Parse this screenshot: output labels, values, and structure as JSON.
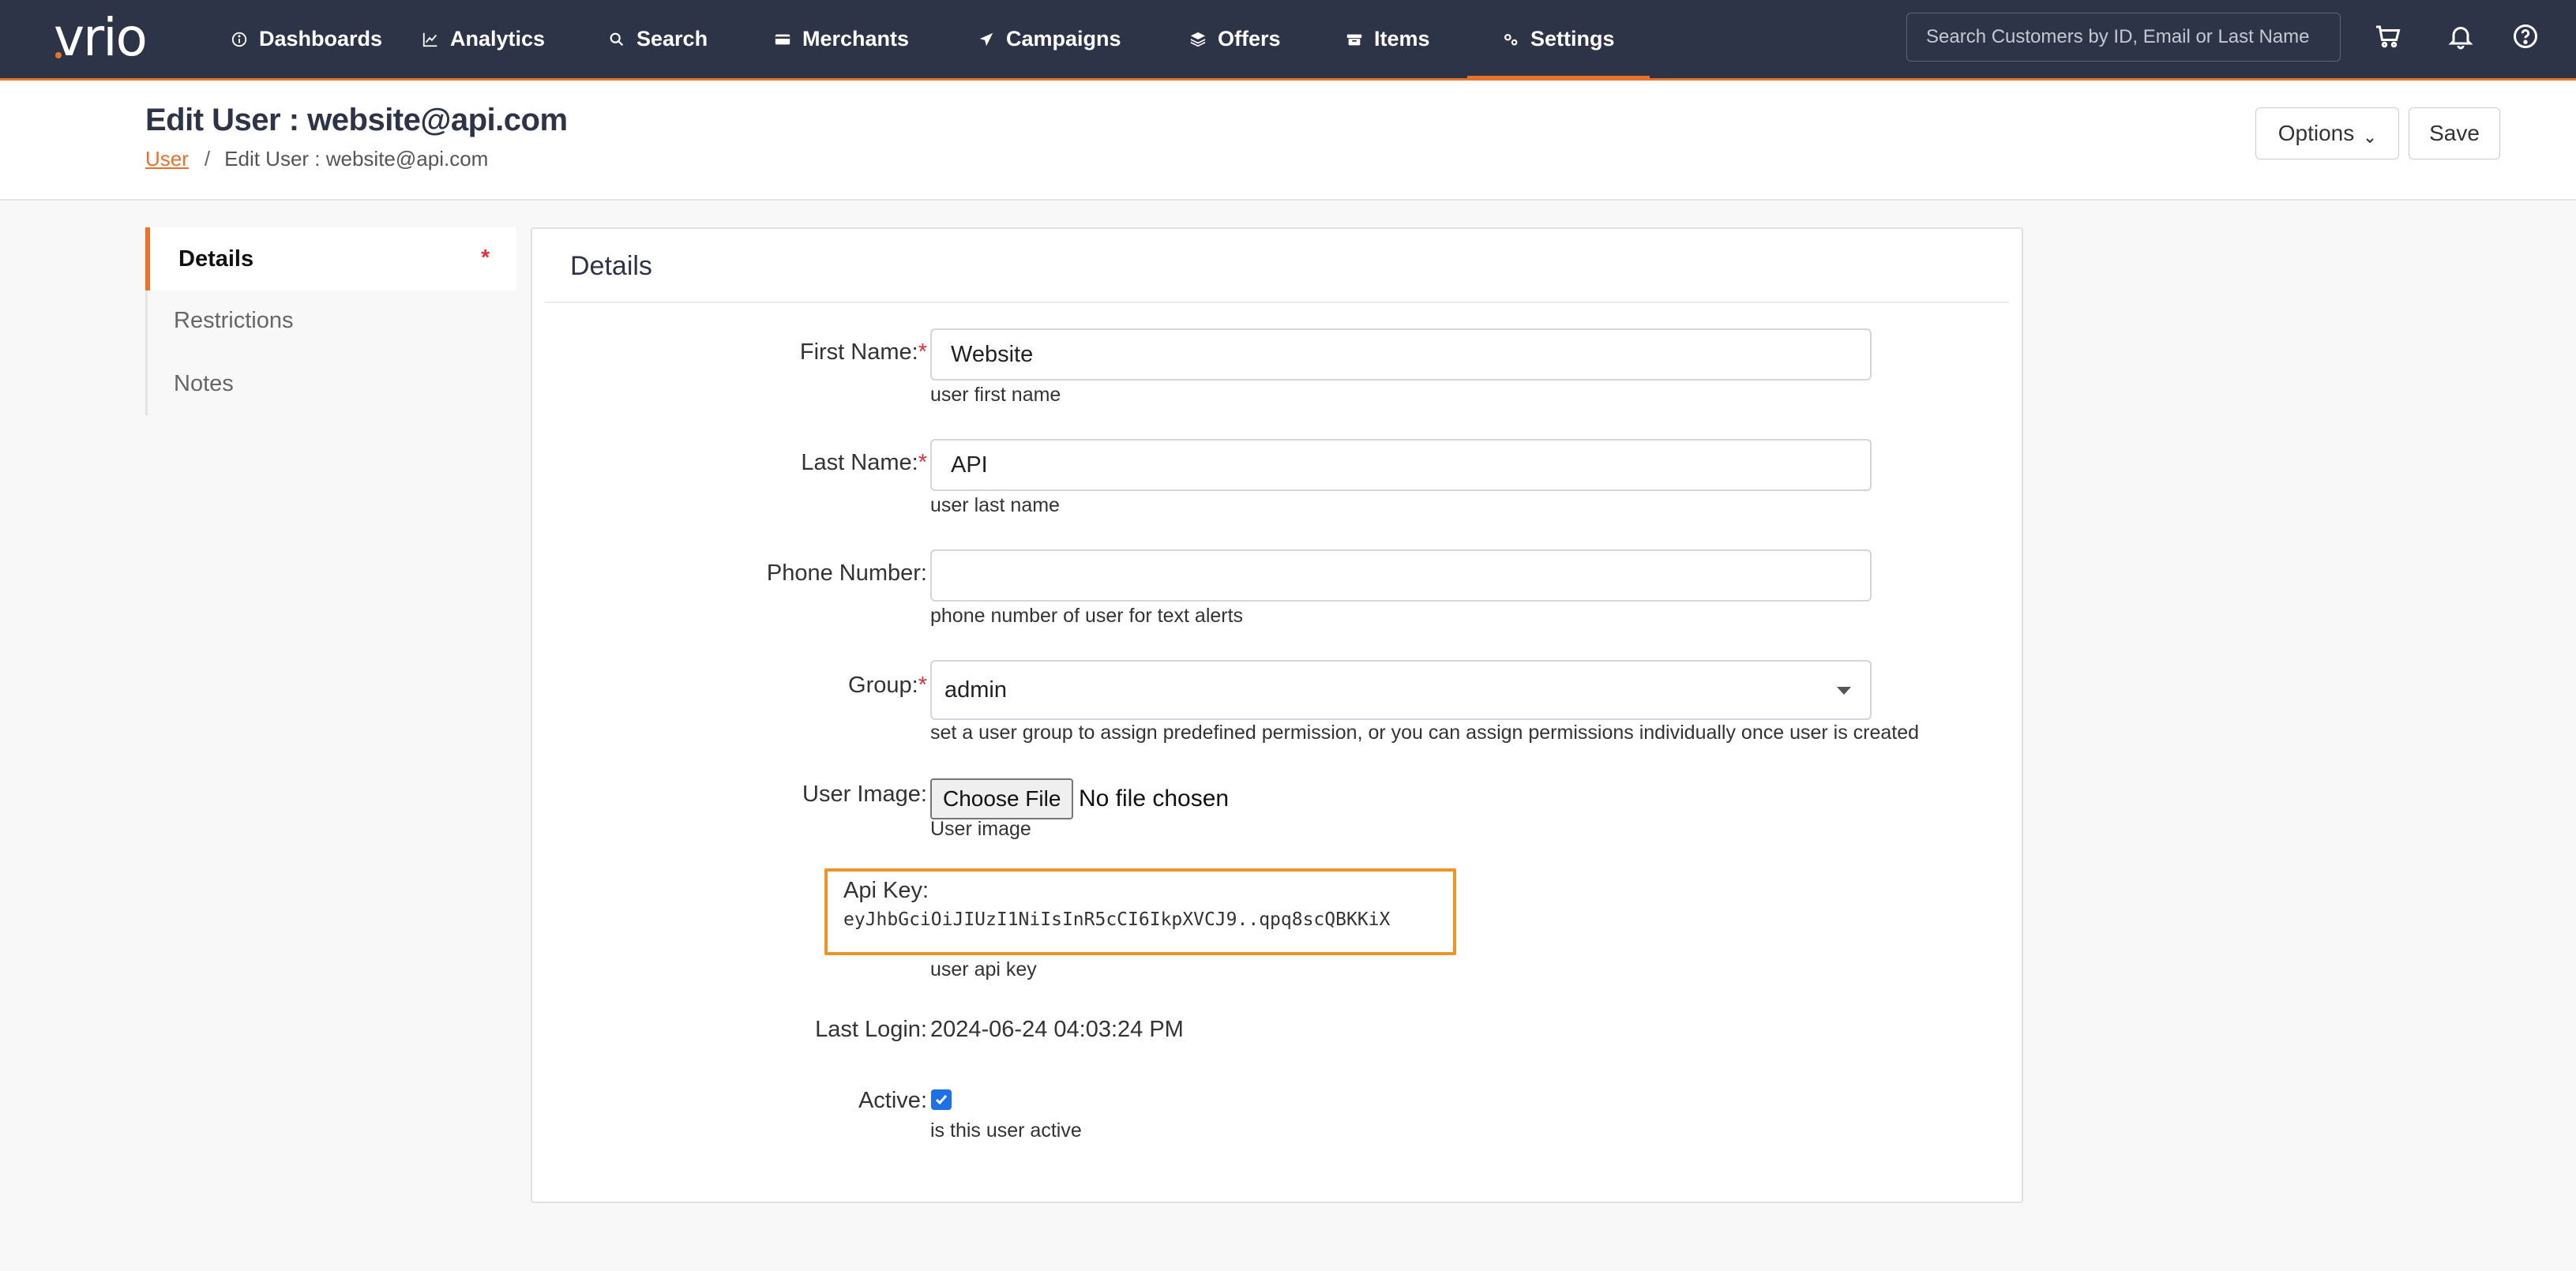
{
  "app": {
    "logo_text": "vrio"
  },
  "nav": {
    "items": [
      {
        "label": "Dashboards",
        "icon": "info-circle-icon"
      },
      {
        "label": "Analytics",
        "icon": "line-chart-icon"
      },
      {
        "label": "Search",
        "icon": "search-icon"
      },
      {
        "label": "Merchants",
        "icon": "credit-card-icon"
      },
      {
        "label": "Campaigns",
        "icon": "send-icon"
      },
      {
        "label": "Offers",
        "icon": "layers-icon"
      },
      {
        "label": "Items",
        "icon": "box-icon"
      },
      {
        "label": "Settings",
        "icon": "gears-icon"
      }
    ],
    "active": "Settings",
    "search_placeholder": "Search Customers by ID, Email or Last Name",
    "icons": [
      "cart-icon",
      "bell-icon",
      "help-circle-icon"
    ]
  },
  "header": {
    "title": "Edit User : website@api.com",
    "breadcrumb": {
      "link": "User",
      "separator": "/",
      "current": "Edit User : website@api.com"
    },
    "options_label": "Options",
    "save_label": "Save"
  },
  "sidebar": {
    "items": [
      {
        "label": "Details",
        "required_marker": "*"
      },
      {
        "label": "Restrictions"
      },
      {
        "label": "Notes"
      }
    ]
  },
  "form": {
    "title": "Details",
    "first_name": {
      "label": "First Name:",
      "required": "*",
      "value": "Website",
      "help": "user first name"
    },
    "last_name": {
      "label": "Last Name:",
      "required": "*",
      "value": "API",
      "help": "user last name"
    },
    "phone": {
      "label": "Phone Number:",
      "value": "",
      "help": "phone number of user for text alerts"
    },
    "group": {
      "label": "Group:",
      "required": "*",
      "value": "admin",
      "help": "set a user group to assign predefined permission, or you can assign permissions individually once user is created"
    },
    "image": {
      "label": "User Image:",
      "button": "Choose File",
      "status": "No file chosen",
      "help": "User image"
    },
    "api_key": {
      "label": "Api Key:",
      "value": "eyJhbGciOiJIUzI1NiIsInR5cCI6IkpXVCJ9..qpq8scQBKKiX",
      "help": "user api key"
    },
    "last_login": {
      "label": "Last Login:",
      "value": "2024-06-24 04:03:24 PM"
    },
    "active": {
      "label": "Active:",
      "checked": true,
      "help": "is this user active"
    }
  },
  "colors": {
    "nav_bg": "#2e3447",
    "accent": "#e8722c",
    "api_highlight": "#ee9326",
    "required": "#e0303a",
    "checkbox": "#1f6fe5"
  }
}
